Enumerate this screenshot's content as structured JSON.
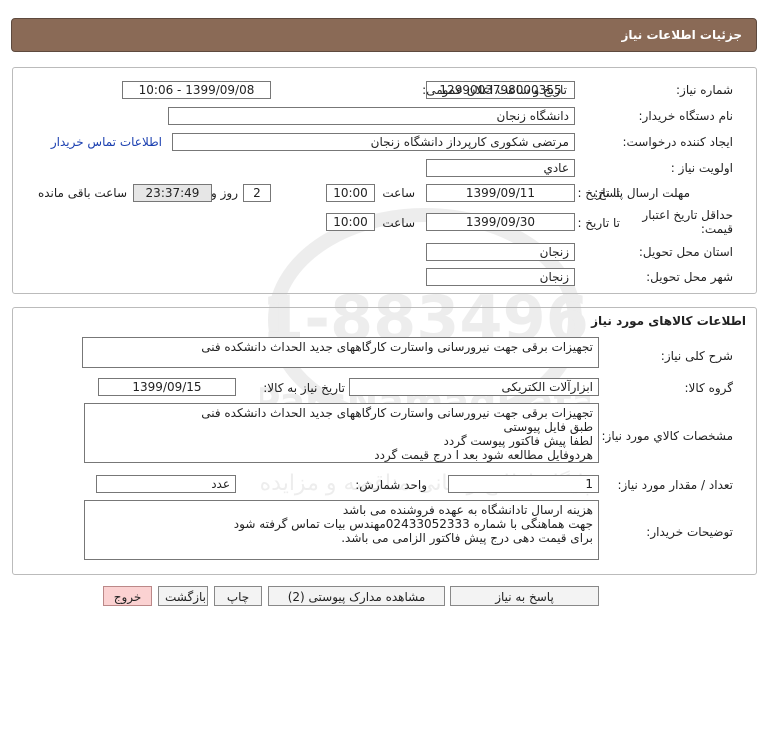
{
  "header": {
    "title": "جزئیات اطلاعات نیاز"
  },
  "watermark": {
    "brand_en": "ParsNamadData",
    "line1_fa": "پایگاه اطلاع رسانی مناقصه و مزایده",
    "line2_fa": "پارس نماد داده ها",
    "phone": "021-88349670"
  },
  "info": {
    "need_number_label": "شماره نیاز:",
    "need_number": "1299003798000355",
    "announce_label": "تاریخ و ساعت اعلان عمومی:",
    "announce_value": "1399/09/08 - 10:06",
    "buyer_org_label": "نام دستگاه خریدار:",
    "buyer_org": "دانشگاه زنجان",
    "creator_label": "ایجاد کننده درخواست:",
    "creator": "مرتضی شکوری کارپرداز دانشگاه زنجان",
    "contact_link": "اطلاعات تماس خریدار",
    "priority_label": "اولویت نیاز :",
    "priority": "عادي",
    "deadline_label": "مهلت ارسال پاسخ:",
    "until_date_label": "تا تاریخ :",
    "deadline_date": "1399/09/11",
    "time_label": "ساعت",
    "deadline_time": "10:00",
    "days_value": "2",
    "days_label": "روز و",
    "remaining_value": "23:37:49",
    "remaining_label": "ساعت باقی مانده",
    "validity_label_1": "حداقل تاریخ اعتبار",
    "validity_label_2": "قیمت:",
    "validity_date": "1399/09/30",
    "validity_time": "10:00",
    "province_label": "استان محل تحویل:",
    "province": "زنجان",
    "city_label": "شهر محل تحویل:",
    "city": "زنجان"
  },
  "goods": {
    "section_title": "اطلاعات کالاهای مورد نیاز",
    "summary_label": "شرح کلی نیاز:",
    "summary": "تجهیزات برقی جهت نیرورسانی واستارت کارگاههای جدید الحداث دانشکده فنی",
    "group_label": "گروه کالا:",
    "group": "ابزارآلات الکتریکی",
    "need_date_label": "تاریخ نیاز به کالا:",
    "need_date": "1399/09/15",
    "specs_label": "مشخصات کالاي مورد نیاز:",
    "specs_lines": [
      "تجهیزات برقی جهت نیرورسانی واستارت کارگاههای جدید الحداث دانشکده فنی",
      "طبق فایل پیوستی",
      "لطفا پیش فاکتور پیوست گردد",
      "هردوفایل مطالعه شود بعد ا درج قیمت گردد"
    ],
    "qty_label": "تعداد / مقدار مورد نیاز:",
    "qty": "1",
    "unit_label": "واحد شمارش:",
    "unit": "عدد",
    "notes_label": "توضیحات خریدار:",
    "notes_lines": [
      "هزینه ارسال تادانشگاه به عهده فروشنده می باشد",
      "جهت هماهنگی با شماره 02433052333مهندس بیات تماس گرفته شود",
      "برای قیمت دهی درج پیش فاکتور الزامی می باشد."
    ]
  },
  "buttons": {
    "reply": "پاسخ به نیاز",
    "attachments": "مشاهده مدارک پیوستی (2)",
    "print": "چاپ",
    "back": "بازگشت",
    "exit": "خروج"
  }
}
